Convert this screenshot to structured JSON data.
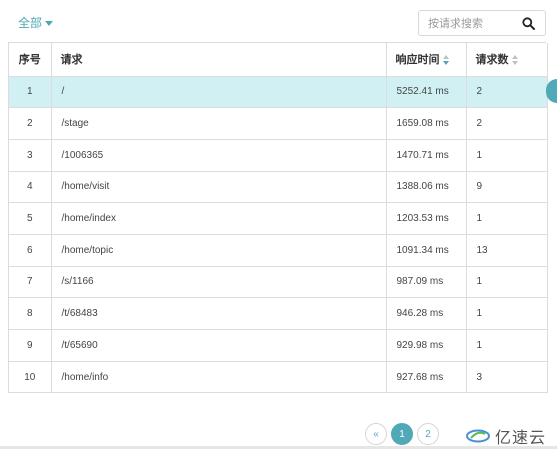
{
  "filter": {
    "label": "全部"
  },
  "search": {
    "placeholder": "按请求搜索"
  },
  "table": {
    "headers": [
      "序号",
      "请求",
      "响应时间",
      "请求数"
    ],
    "rows": [
      {
        "no": "1",
        "request": "/",
        "time": "5252.41 ms",
        "count": "2"
      },
      {
        "no": "2",
        "request": "/stage",
        "time": "1659.08 ms",
        "count": "2"
      },
      {
        "no": "3",
        "request": "/1006365",
        "time": "1470.71 ms",
        "count": "1"
      },
      {
        "no": "4",
        "request": "/home/visit",
        "time": "1388.06 ms",
        "count": "9"
      },
      {
        "no": "5",
        "request": "/home/index",
        "time": "1203.53 ms",
        "count": "1"
      },
      {
        "no": "6",
        "request": "/home/topic",
        "time": "1091.34 ms",
        "count": "13"
      },
      {
        "no": "7",
        "request": "/s/1166",
        "time": "987.09 ms",
        "count": "1"
      },
      {
        "no": "8",
        "request": "/t/68483",
        "time": "946.28 ms",
        "count": "1"
      },
      {
        "no": "9",
        "request": "/t/65690",
        "time": "929.98 ms",
        "count": "1"
      },
      {
        "no": "10",
        "request": "/home/info",
        "time": "927.68 ms",
        "count": "3"
      }
    ]
  },
  "pagination": {
    "prev": "«",
    "pages": [
      "1",
      "2"
    ],
    "current": "1"
  },
  "watermark": {
    "text": "亿速云"
  },
  "colors": {
    "accent": "#4fa9b7",
    "active_row": "#d1f0f3",
    "border": "#dcdcdc"
  },
  "icons": {
    "search": "search-icon",
    "filter_caret": "caret-down-icon",
    "sort": "sort-icon",
    "logo": "yisu-cloud-logo-icon"
  }
}
